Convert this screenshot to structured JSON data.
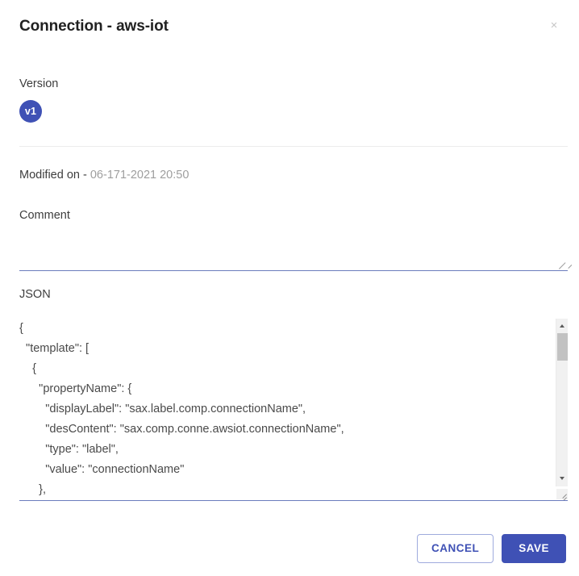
{
  "dialog": {
    "title": "Connection - aws-iot",
    "close_icon": "close-icon",
    "close_label": "×"
  },
  "version": {
    "label": "Version",
    "chip_value": "v1",
    "chip_color": "#3f51b5"
  },
  "modified": {
    "label": "Modified on -",
    "value": "06-171-2021 20:50"
  },
  "comment": {
    "label": "Comment",
    "value": "",
    "placeholder": ""
  },
  "json": {
    "label": "JSON",
    "value": "{\n  \"template\": [\n    {\n      \"propertyName\": {\n        \"displayLabel\": \"sax.label.comp.connectionName\",\n        \"desContent\": \"sax.comp.conne.awsiot.connectionName\",\n        \"type\": \"label\",\n        \"value\": \"connectionName\"\n      },",
    "scrollbar": {
      "up_icon": "chevron-up-icon",
      "down_icon": "chevron-down-icon"
    }
  },
  "footer": {
    "cancel_label": "CANCEL",
    "save_label": "SAVE",
    "accent_color": "#3f51b5"
  }
}
